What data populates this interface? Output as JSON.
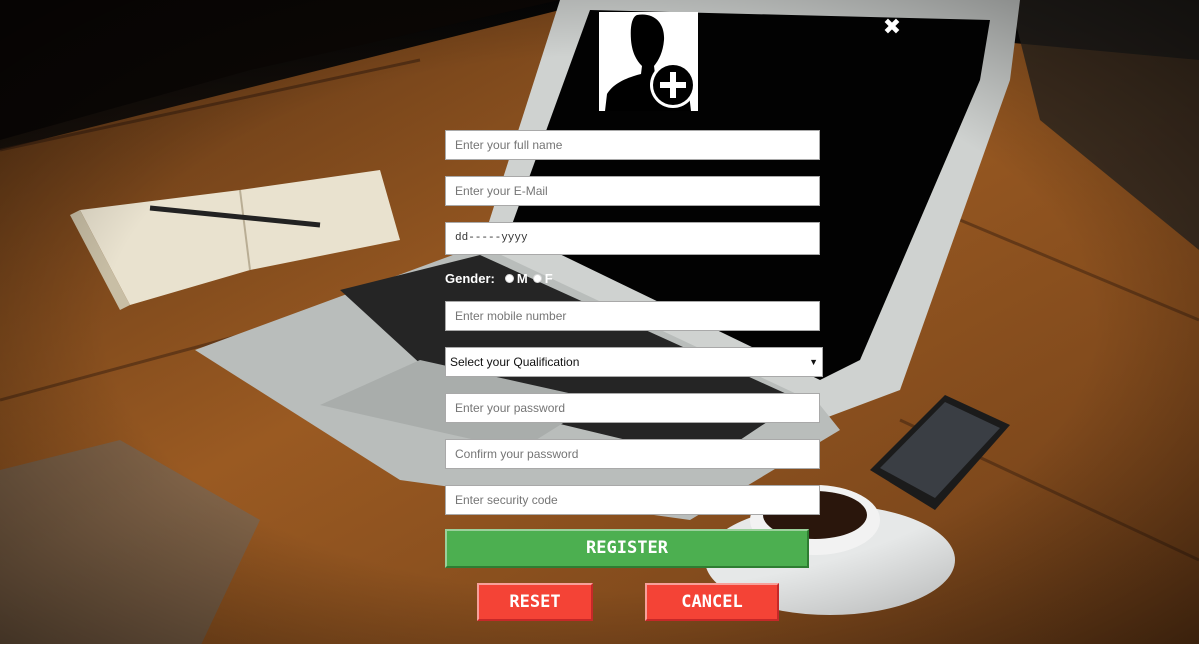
{
  "icons": {
    "close": "close-icon",
    "avatar": "add-user-icon"
  },
  "form": {
    "fullname_placeholder": "Enter your full name",
    "email_placeholder": "Enter your E-Mail",
    "date_value": "dd-----yyyy",
    "gender_label": "Gender:",
    "gender_options": [
      "M",
      "F"
    ],
    "mobile_placeholder": "Enter mobile number",
    "qualification_selected": "Select your Qualification",
    "password_placeholder": "Enter your password",
    "confirm_placeholder": "Confirm your password",
    "security_placeholder": "Enter security code"
  },
  "buttons": {
    "register": "REGISTER",
    "reset": "RESET",
    "cancel": "CANCEL"
  },
  "colors": {
    "register": "#4caf50",
    "reset": "#f44336",
    "cancel": "#f44336"
  }
}
